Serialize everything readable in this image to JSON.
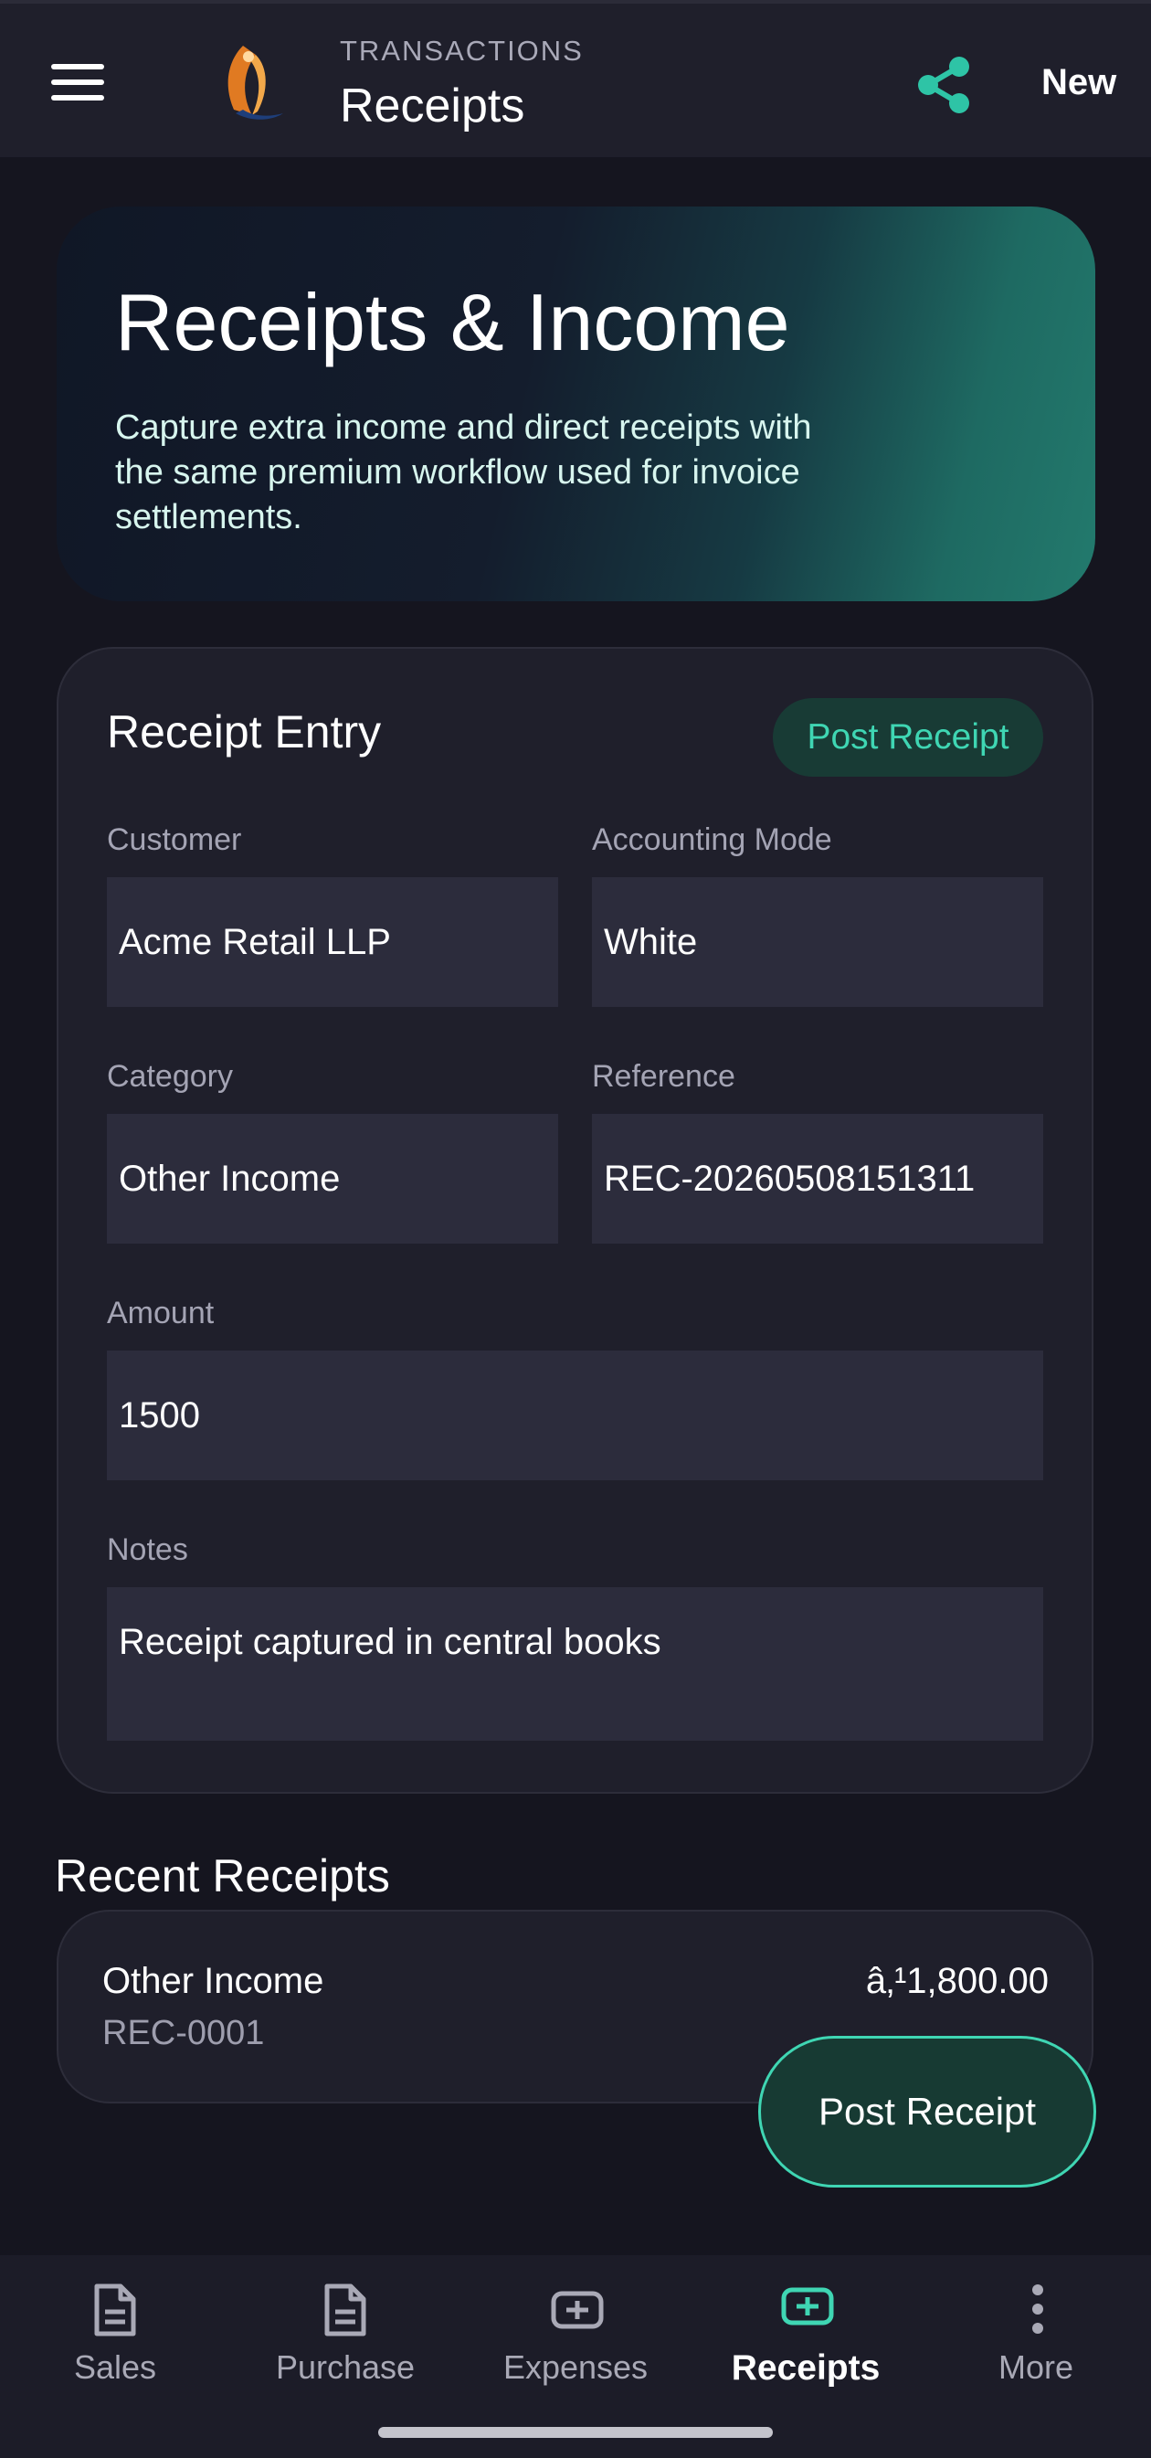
{
  "header": {
    "section_label": "TRANSACTIONS",
    "title": "Receipts",
    "new_label": "New",
    "share_icon_color": "#2ec4a6"
  },
  "hero": {
    "title": "Receipts & Income",
    "subtitle_lines": [
      "Capture extra income and direct receipts with",
      "the same premium workflow used for invoice",
      "settlements."
    ]
  },
  "form": {
    "title": "Receipt Entry",
    "post_label": "Post Receipt",
    "customer": {
      "label": "Customer",
      "value": "Acme Retail LLP"
    },
    "accounting_mode": {
      "label": "Accounting Mode",
      "value": "White"
    },
    "category": {
      "label": "Category",
      "value": "Other Income"
    },
    "reference": {
      "label": "Reference",
      "value": "REC-20260508151311"
    },
    "amount": {
      "label": "Amount",
      "value": "1500"
    },
    "notes": {
      "label": "Notes",
      "value": "Receipt captured in central books"
    }
  },
  "recent": {
    "title": "Recent Receipts",
    "items": [
      {
        "title": "Other Income",
        "ref": "REC-0001",
        "amount": "â‚¹1,800.00"
      }
    ]
  },
  "fab": {
    "label": "Post Receipt"
  },
  "nav": {
    "items": [
      {
        "label": "Sales",
        "icon": "document-icon",
        "active": false
      },
      {
        "label": "Purchase",
        "icon": "document-icon",
        "active": false
      },
      {
        "label": "Expenses",
        "icon": "plus-box-icon",
        "active": false
      },
      {
        "label": "Receipts",
        "icon": "plus-box-icon",
        "active": true
      },
      {
        "label": "More",
        "icon": "more-vertical-icon",
        "active": false
      }
    ]
  },
  "colors": {
    "accent": "#3fd6b3",
    "background": "#15151f",
    "card": "#1f1f2b",
    "field": "#2c2c3c"
  }
}
